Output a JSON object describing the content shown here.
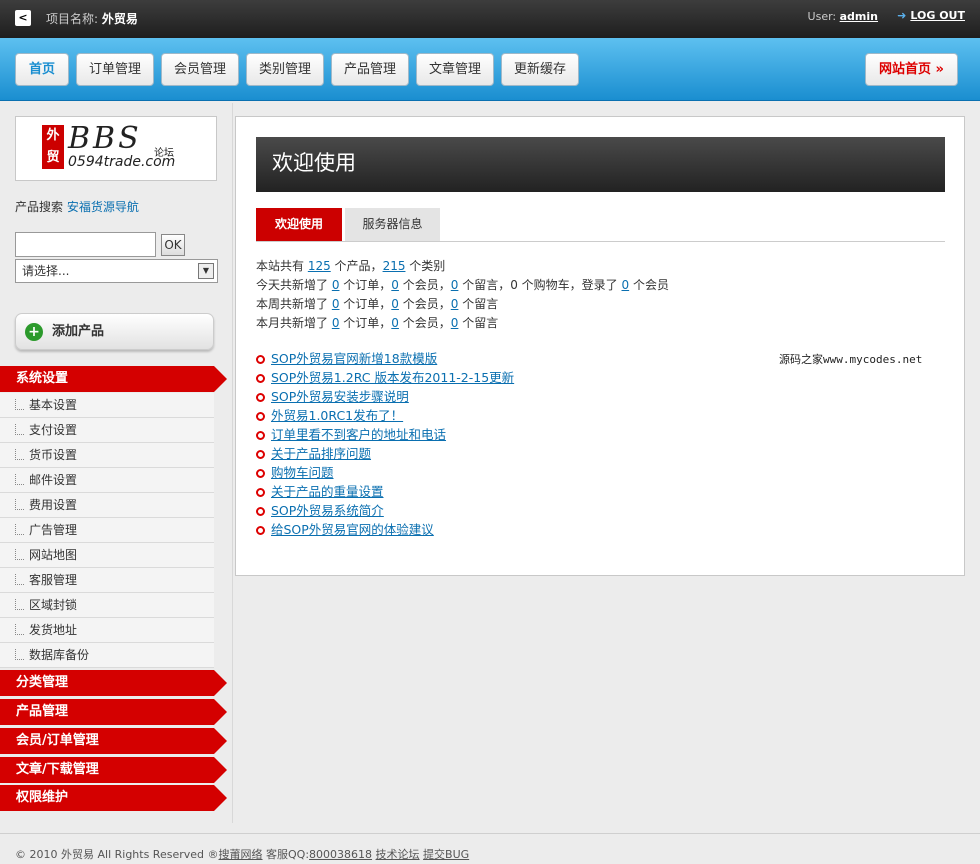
{
  "topbar": {
    "back_label": "<",
    "project_label": "项目名称:",
    "project_name": "外贸易",
    "user_label": "User:",
    "user_name": "admin",
    "logout_label": "LOG OUT"
  },
  "nav": {
    "items": [
      "首页",
      "订单管理",
      "会员管理",
      "类别管理",
      "产品管理",
      "文章管理",
      "更新缓存"
    ],
    "site_home": "网站首页 »"
  },
  "logo": {
    "mark": "外贸",
    "bbs": "BBS",
    "forum": "论坛",
    "domain": "0594trade.com"
  },
  "search": {
    "label": "产品搜索",
    "link": "安福货源导航",
    "input_value": "",
    "ok_label": "OK",
    "select_value": "请选择..."
  },
  "add_product": {
    "icon": "plus-icon",
    "label": "添加产品"
  },
  "sidebar": {
    "sections": [
      {
        "title": "系统设置",
        "items": [
          "基本设置",
          "支付设置",
          "货币设置",
          "邮件设置",
          "费用设置",
          "广告管理",
          "网站地图",
          "客服管理",
          "区域封锁",
          "发货地址",
          "数据库备份"
        ]
      },
      {
        "title": "分类管理",
        "items": []
      },
      {
        "title": "产品管理",
        "items": []
      },
      {
        "title": "会员/订单管理",
        "items": []
      },
      {
        "title": "文章/下载管理",
        "items": []
      },
      {
        "title": "权限维护",
        "items": []
      }
    ]
  },
  "main": {
    "heading": "欢迎使用",
    "tabs": [
      "欢迎使用",
      "服务器信息"
    ],
    "stats": {
      "line1": {
        "a": "本站共有 ",
        "products": "125",
        "b": " 个产品，",
        "categories": "215",
        "c": " 个类别"
      },
      "line2": {
        "a": "今天共新增了 ",
        "orders": "0",
        "b": " 个订单，",
        "members": "0",
        "c": " 个会员，",
        "messages": "0",
        "d": " 个留言，0 个购物车，登录了 ",
        "logins": "0",
        "e": " 个会员"
      },
      "line3": {
        "a": "本周共新增了 ",
        "orders": "0",
        "b": " 个订单，",
        "members": "0",
        "c": " 个会员，",
        "messages": "0",
        "d": " 个留言"
      },
      "line4": {
        "a": "本月共新增了 ",
        "orders": "0",
        "b": " 个订单，",
        "members": "0",
        "c": " 个会员，",
        "messages": "0",
        "d": " 个留言"
      }
    },
    "news": [
      "SOP外贸易官网新增18款模版",
      "SOP外贸易1.2RC 版本发布2011-2-15更新",
      "SOP外贸易安装步骤说明",
      "外贸易1.0RC1发布了！",
      "订单里看不到客户的地址和电话",
      "关于产品排序问题",
      "购物车问题",
      "关于产品的重量设置",
      "SOP外贸易系统简介",
      "给SOP外贸易官网的体验建议"
    ],
    "watermark": "源码之家www.mycodes.net"
  },
  "footer": {
    "copyright": "© 2010 外贸易 All Rights Reserved ®",
    "company": "搜莆网络",
    "qq_label": " 客服QQ:",
    "qq": "800038618",
    "forum": "技术论坛",
    "bug": "提交BUG"
  },
  "colors": {
    "accent_red": "#d40000",
    "nav_blue": "#1a8ed0",
    "link_blue": "#0a6fb0"
  }
}
